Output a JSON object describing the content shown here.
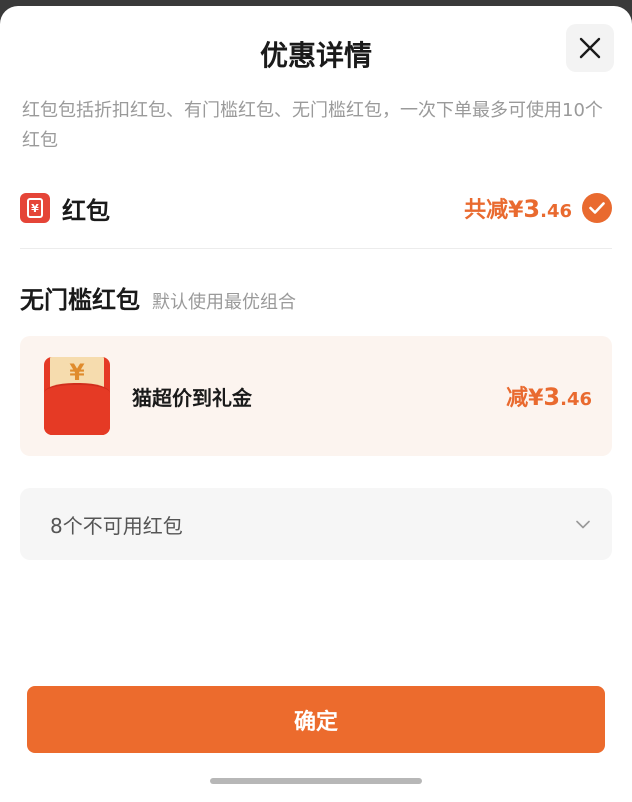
{
  "header": {
    "title": "优惠详情",
    "close_icon": "close-icon"
  },
  "description": "红包包括折扣红包、有门槛红包、无门槛红包，一次下单最多可使用10个红包",
  "hongbao": {
    "icon": "red-envelope-icon",
    "icon_glyph": "¥",
    "label": "红包",
    "total_prefix": "共减¥",
    "total_int": "3",
    "total_dec": ".46",
    "selected": true,
    "accent": "#e96a2f"
  },
  "section": {
    "title": "无门槛红包",
    "subtitle": "默认使用最优组合"
  },
  "coupon": {
    "icon": "red-envelope-image",
    "icon_glyph": "¥",
    "name": "猫超价到礼金",
    "amount_prefix": "减¥",
    "amount_int": "3",
    "amount_dec": ".46"
  },
  "unusable": {
    "label": "8个不可用红包",
    "icon": "chevron-down-icon"
  },
  "confirm_button": {
    "label": "确定",
    "color": "#ec6b2d"
  }
}
